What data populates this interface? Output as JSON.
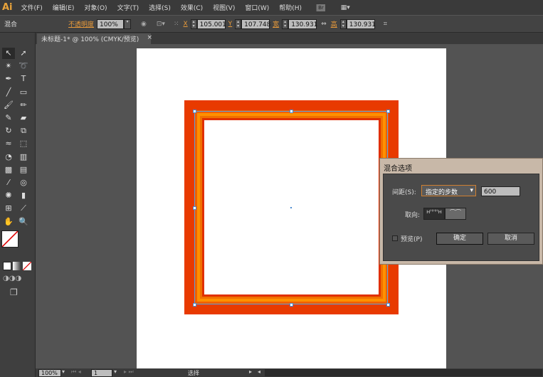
{
  "app": {
    "logo": "Ai"
  },
  "menu": [
    "文件(F)",
    "编辑(E)",
    "对象(O)",
    "文字(T)",
    "选择(S)",
    "效果(C)",
    "视图(V)",
    "窗口(W)",
    "帮助(H)"
  ],
  "menu_icons": {
    "bridge": "Br"
  },
  "control": {
    "object_type": "混合",
    "opacity_label": "不透明度",
    "opacity": "100%",
    "x_label": "X",
    "x": "105.001",
    "y_label": "Y",
    "y": "107.748",
    "w_label": "宽",
    "w": "130.931",
    "h_label": "高",
    "h": "130.931"
  },
  "tab": {
    "title": "未标题-1* @ 100% (CMYK/预览)",
    "close": "×"
  },
  "tools": [
    "selection",
    "direct-selection",
    "magic-wand",
    "lasso",
    "pen",
    "type",
    "line",
    "rectangle",
    "paintbrush",
    "pencil",
    "blob-brush",
    "eraser",
    "rotate",
    "scale",
    "warp",
    "free-transform",
    "shape-builder",
    "perspective-grid",
    "mesh",
    "gradient",
    "eyedropper",
    "blend",
    "symbol-sprayer",
    "column-graph",
    "artboard",
    "slice",
    "hand",
    "zoom"
  ],
  "dialog": {
    "title": "混合选项",
    "spacing_label": "间距(S):",
    "spacing_value": "指定的步数",
    "steps": "600",
    "orientation_label": "取向:",
    "preview_label": "预览(P)",
    "preview_checked": false,
    "ok": "确定",
    "cancel": "取消"
  },
  "status": {
    "zoom": "100%",
    "page": "1",
    "tool": "选择"
  },
  "colors": {
    "blend_outer": "#e83a00",
    "blend_inner": "#ffe000",
    "accent": "#e8a33a"
  }
}
